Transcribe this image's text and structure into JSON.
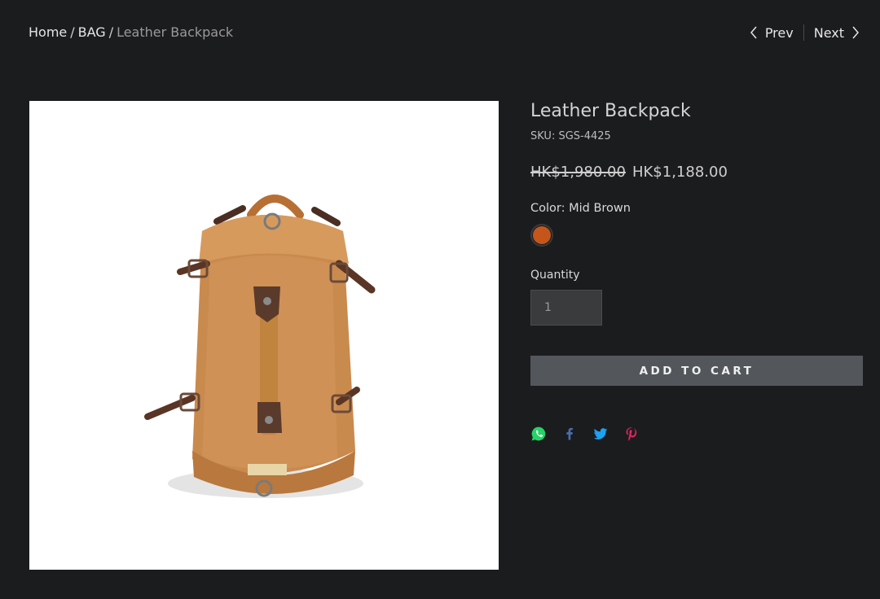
{
  "breadcrumb": {
    "home": "Home",
    "category": "BAG",
    "current": "Leather Backpack",
    "separator": "/"
  },
  "pager": {
    "prev_label": "Prev",
    "next_label": "Next"
  },
  "product": {
    "title": "Leather Backpack",
    "sku": "SKU: SGS-4425",
    "old_price": "HK$1,980.00",
    "new_price": "HK$1,188.00",
    "color_label": "Color: Mid Brown",
    "swatch_color": "#c4561c",
    "quantity_label": "Quantity",
    "quantity_value": "1",
    "add_to_cart": "ADD TO CART"
  },
  "share": {
    "icons": [
      "whatsapp-icon",
      "facebook-icon",
      "twitter-icon",
      "pinterest-icon"
    ],
    "colors": {
      "whatsapp": "#25d366",
      "facebook": "#4a6ea9",
      "twitter": "#1da1f2",
      "pinterest": "#e0245e"
    }
  },
  "image": {
    "icon": "leather-backpack-photo"
  }
}
